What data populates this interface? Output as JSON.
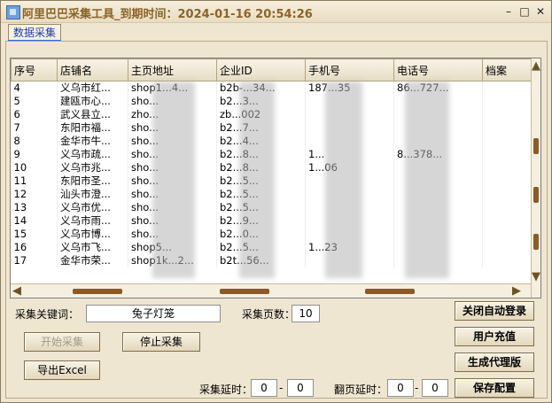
{
  "window": {
    "title": "阿里巴巴采集工具_到期时间：2024-01-16 20:54:26",
    "min_glyph": "–",
    "max_glyph": "□",
    "close_glyph": "✕"
  },
  "tab": {
    "label": "数据采集"
  },
  "table": {
    "columns": [
      "序号",
      "店铺名",
      "主页地址",
      "企业ID",
      "手机号",
      "电话号",
      "档案"
    ],
    "rows": [
      [
        "4",
        "义乌市红...",
        "shop1...4...",
        "b2b-...34...",
        "187...35",
        "86...727...",
        ""
      ],
      [
        "5",
        "建瓯市心...",
        "sho...",
        "b2...3...",
        "",
        "",
        ""
      ],
      [
        "6",
        "武义县立...",
        "zho...",
        "zb...002",
        "",
        "",
        ""
      ],
      [
        "7",
        "东阳市福...",
        "sho...",
        "b2...7...",
        "",
        "",
        ""
      ],
      [
        "8",
        "金华市牛...",
        "sho...",
        "b2...4...",
        "",
        "",
        ""
      ],
      [
        "9",
        "义乌市疏...",
        "sho...",
        "b2...8...",
        "1...",
        "8...378...",
        ""
      ],
      [
        "10",
        "义乌市兆...",
        "sho...",
        "b2...8...",
        "1...06",
        "",
        ""
      ],
      [
        "11",
        "东阳市圣...",
        "sho...",
        "b2...5...",
        "",
        "",
        ""
      ],
      [
        "12",
        "汕头市澄...",
        "sho...",
        "b2...5...",
        "",
        "",
        ""
      ],
      [
        "13",
        "义乌市优...",
        "sho...",
        "b2...5...",
        "",
        "",
        ""
      ],
      [
        "14",
        "义乌市雨...",
        "sho...",
        "b2...9...",
        "",
        "",
        ""
      ],
      [
        "15",
        "义乌市博...",
        "sho...",
        "b2...0...",
        "",
        "",
        ""
      ],
      [
        "16",
        "义乌市飞...",
        "shop5...",
        "b2...5...",
        "1...23",
        "",
        ""
      ],
      [
        "17",
        "金华市荣...",
        "shop1k...2...",
        "b2t...56...",
        "",
        "",
        ""
      ]
    ]
  },
  "form": {
    "keyword_label": "采集关键词：",
    "keyword_value": "兔子灯笼",
    "pages_label": "采集页数：",
    "pages_value": "10",
    "delay_label": "采集延时：",
    "delay_from": "0",
    "delay_sep": "-",
    "delay_to": "0",
    "page_delay_label": "翻页延时：",
    "page_delay_from": "0",
    "page_delay_sep": "-",
    "page_delay_to": "0"
  },
  "buttons": {
    "start": "开始采集",
    "stop": "停止采集",
    "export": "导出Excel",
    "close_auto_login": "关闭自动登录",
    "recharge": "用户充值",
    "gen_proxy": "生成代理版",
    "save_config": "保存配置"
  }
}
